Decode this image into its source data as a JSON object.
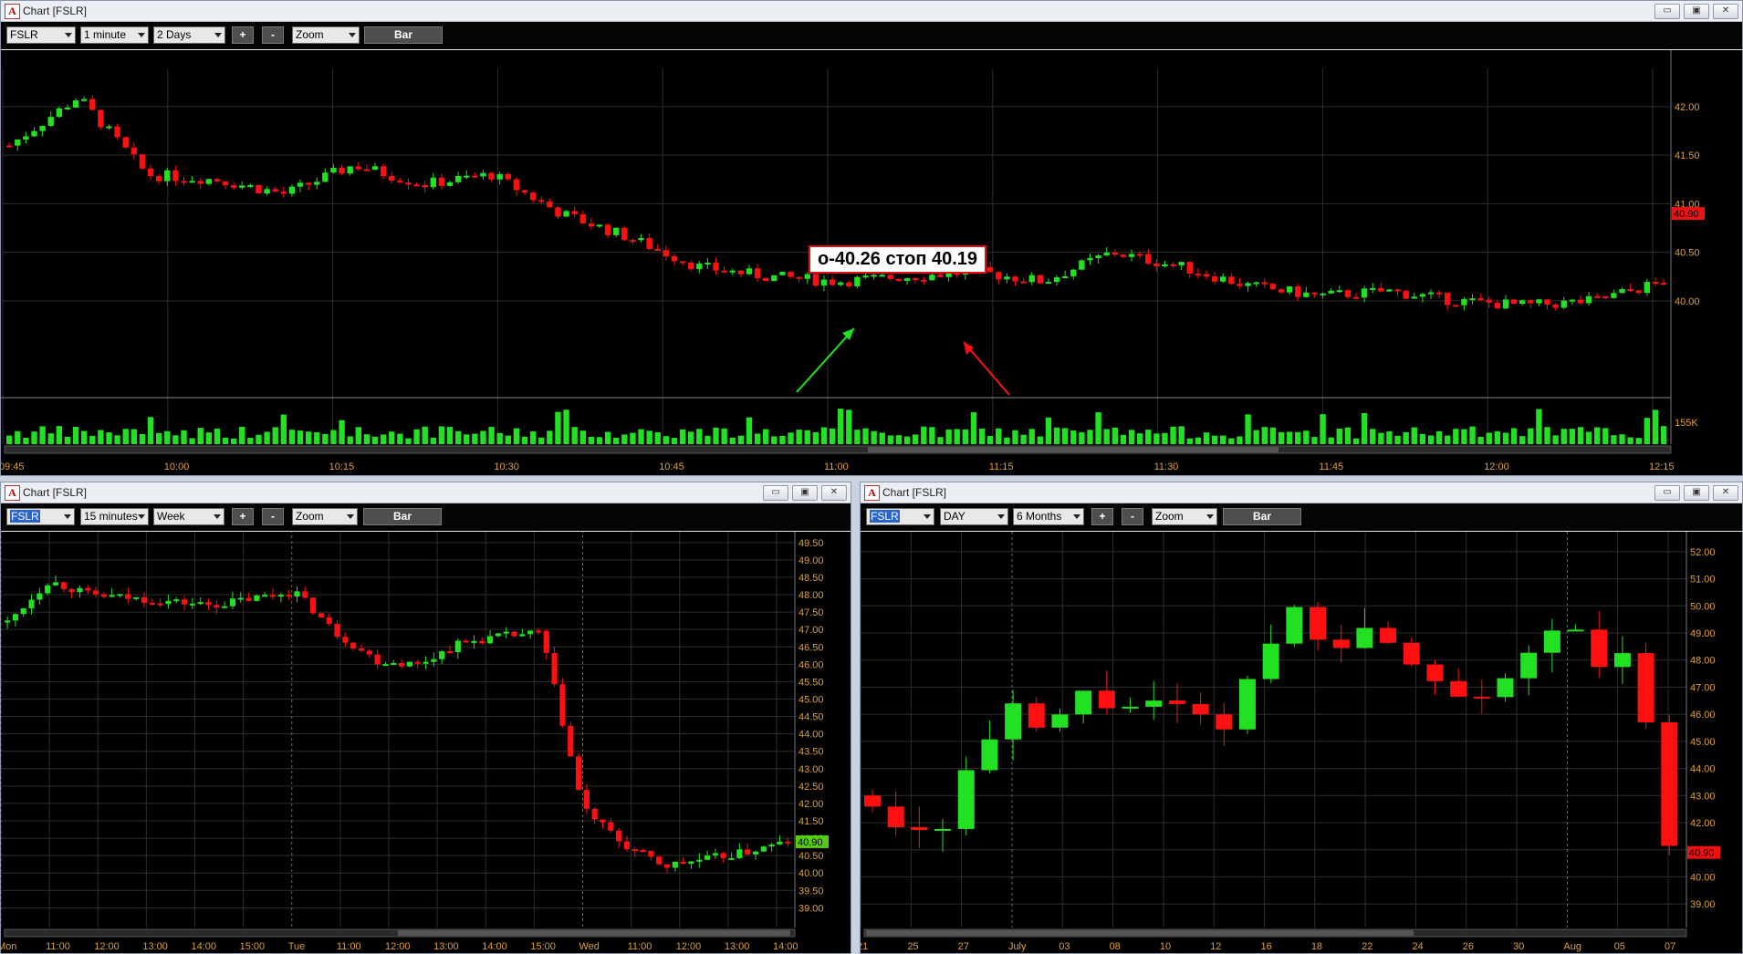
{
  "windows": [
    {
      "id": "top",
      "title": "Chart [FSLR]",
      "symbol": "FSLR",
      "interval": "1 minute",
      "range": "2 Days",
      "zoom": "Zoom",
      "bar_label": "Bar",
      "plus": "+",
      "minus": "-",
      "y_labels": [
        "42.00",
        "41.50",
        "41.00",
        "40.50",
        "40.00"
      ],
      "price_tag": "40.90",
      "volume_label": "155K",
      "x_labels": [
        "09:45",
        "10:00",
        "10:15",
        "10:30",
        "10:45",
        "11:00",
        "11:15",
        "11:30",
        "11:45",
        "12:00",
        "12:15"
      ],
      "annotation": "о-40.26 стоп 40.19"
    },
    {
      "id": "bottom-left",
      "title": "Chart [FSLR]",
      "symbol": "FSLR",
      "interval": "15 minutes",
      "range": "Week",
      "zoom": "Zoom",
      "bar_label": "Bar",
      "plus": "+",
      "minus": "-",
      "y_labels": [
        "49.50",
        "49.00",
        "48.50",
        "48.00",
        "47.50",
        "47.00",
        "46.50",
        "46.00",
        "45.50",
        "45.00",
        "44.50",
        "44.00",
        "43.50",
        "43.00",
        "42.50",
        "42.00",
        "41.50",
        "41.00",
        "40.50",
        "40.00",
        "39.50",
        "39.00"
      ],
      "price_tag": "40.90",
      "x_labels": [
        "Mon",
        "11:00",
        "12:00",
        "13:00",
        "14:00",
        "15:00",
        "Tue",
        "11:00",
        "12:00",
        "13:00",
        "14:00",
        "15:00",
        "Wed",
        "11:00",
        "12:00",
        "13:00",
        "14:00"
      ]
    },
    {
      "id": "bottom-right",
      "title": "Chart [FSLR]",
      "symbol": "FSLR",
      "interval": "DAY",
      "range": "6 Months",
      "zoom": "Zoom",
      "bar_label": "Bar",
      "plus": "+",
      "minus": "-",
      "y_labels": [
        "52.00",
        "51.00",
        "50.00",
        "49.00",
        "48.00",
        "47.00",
        "46.00",
        "45.00",
        "44.00",
        "43.00",
        "42.00",
        "41.00",
        "40.00",
        "39.00"
      ],
      "price_tag": "40.90",
      "x_labels": [
        "21",
        "25",
        "27",
        "July",
        "03",
        "08",
        "10",
        "12",
        "16",
        "18",
        "22",
        "24",
        "26",
        "30",
        "Aug",
        "05",
        "07"
      ]
    }
  ],
  "window_buttons": [
    "▭",
    "▣",
    "✕"
  ],
  "colors": {
    "up": "#22e022",
    "down": "#ff1010",
    "grid": "#2e2e2e",
    "axis_text": "#e0a030",
    "tag": "#ee1111",
    "tag_green": "#55cc11"
  }
}
